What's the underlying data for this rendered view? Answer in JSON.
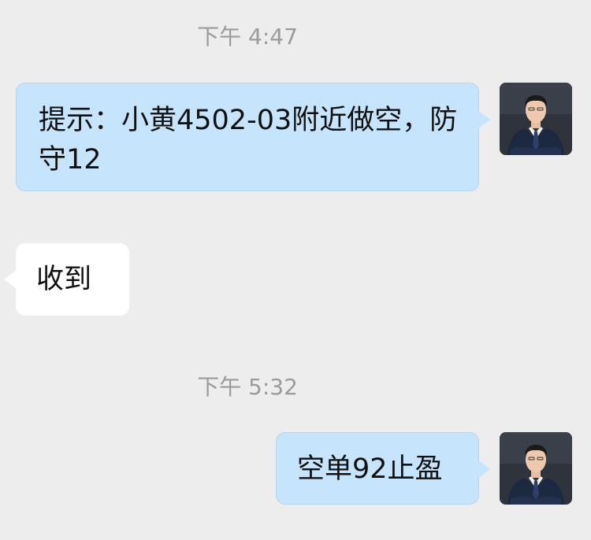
{
  "chat": {
    "messages": [
      {
        "timestamp": "下午 4:47",
        "text": "提示：小黄4502-03附近做空，防守12",
        "side": "right",
        "avatar_icon": "person-suit-avatar-icon"
      },
      {
        "text": "收到",
        "side": "left"
      },
      {
        "timestamp": "下午 5:32",
        "text": "空单92止盈",
        "side": "right",
        "avatar_icon": "person-suit-avatar-icon"
      }
    ]
  },
  "colors": {
    "background": "#ededed",
    "sent_bubble": "#c6e4fb",
    "received_bubble": "#ffffff",
    "timestamp_text": "#9b9b9b",
    "message_text": "#111111"
  }
}
